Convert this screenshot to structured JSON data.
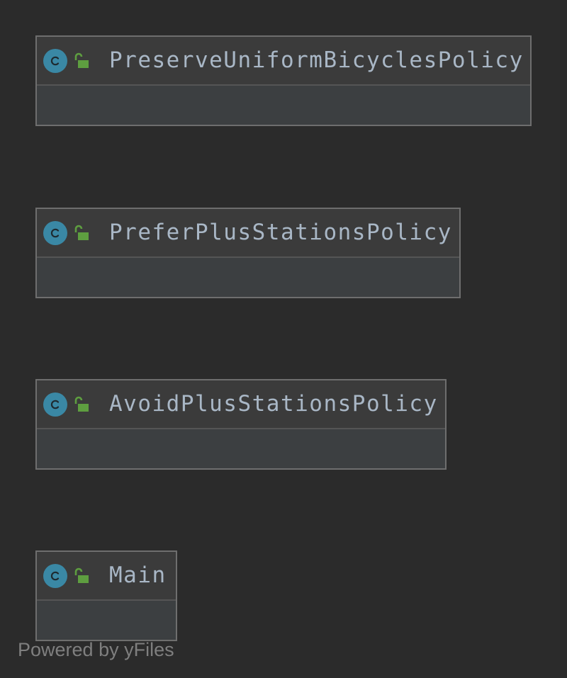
{
  "diagram": {
    "classes": [
      {
        "name": "PreserveUniformBicyclesPolicy",
        "kind": "class",
        "visibility": "public"
      },
      {
        "name": "PreferPlusStationsPolicy",
        "kind": "class",
        "visibility": "public"
      },
      {
        "name": "AvoidPlusStationsPolicy",
        "kind": "class",
        "visibility": "public"
      },
      {
        "name": "Main",
        "kind": "class",
        "visibility": "public"
      }
    ],
    "icons": {
      "class_icon": "class-c-icon",
      "visibility_icon": "open-lock-icon"
    },
    "colors": {
      "background": "#2b2b2b",
      "class_icon": "#3a88a5",
      "lock_icon": "#5e9e40",
      "text": "#a9b7c6"
    }
  },
  "watermark": "Powered by yFiles"
}
